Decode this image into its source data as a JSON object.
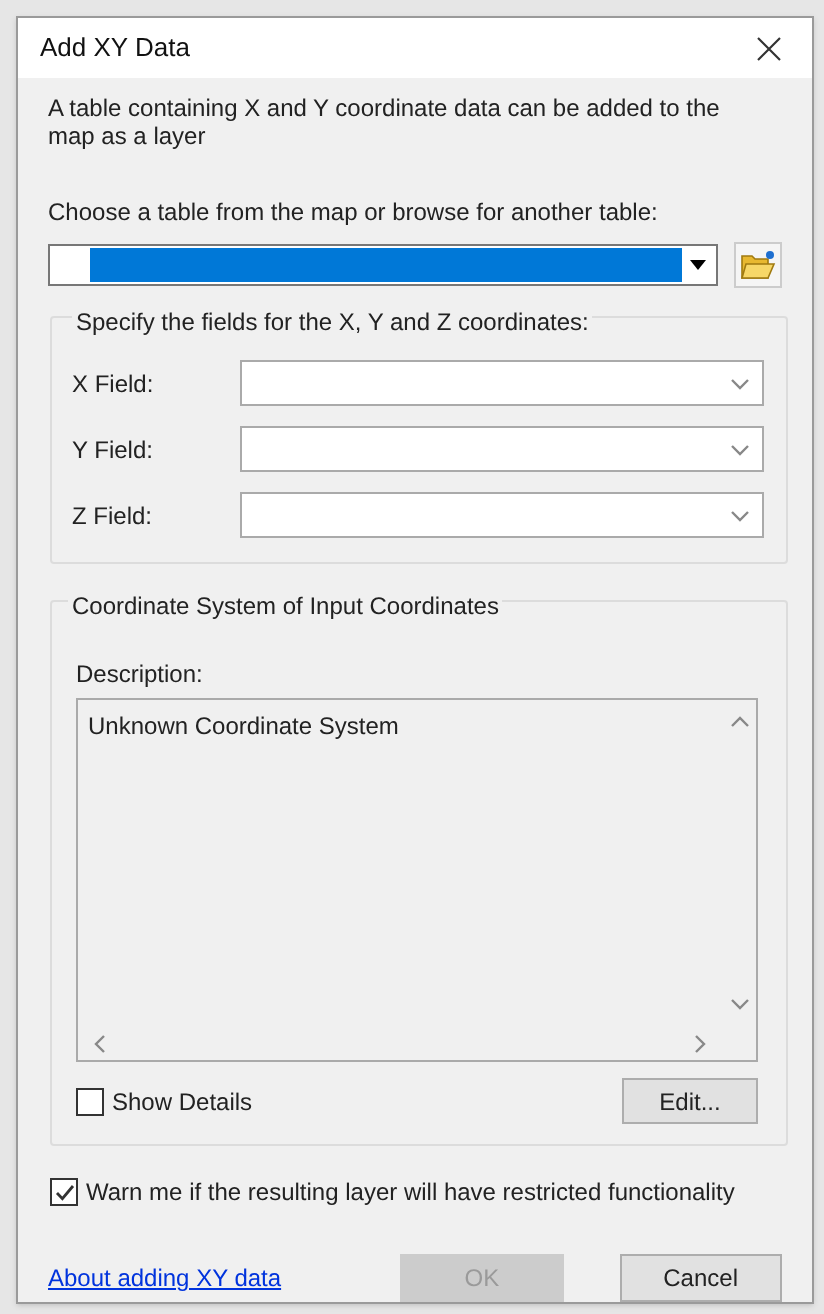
{
  "window": {
    "title": "Add XY Data"
  },
  "intro": "A table containing X and Y coordinate data can be added to the map as a layer",
  "table_prompt": "Choose a table from the map or browse for another table:",
  "fields_group": {
    "title": "Specify the fields for the X, Y and Z coordinates:",
    "fields": [
      {
        "label": "X Field:"
      },
      {
        "label": "Y Field:"
      },
      {
        "label": "Z Field:"
      }
    ]
  },
  "coordinate_group": {
    "title": "Coordinate System of Input Coordinates",
    "description_label": "Description:",
    "description": "Unknown Coordinate System",
    "show_details": {
      "label": "Show Details",
      "checked": false
    },
    "edit_button": "Edit..."
  },
  "warn": {
    "label": "Warn me if the resulting layer will have restricted functionality",
    "checked": true
  },
  "help_link": "About adding XY data",
  "buttons": [
    {
      "label": "OK",
      "disabled": true
    },
    {
      "label": "Cancel",
      "disabled": false
    }
  ]
}
